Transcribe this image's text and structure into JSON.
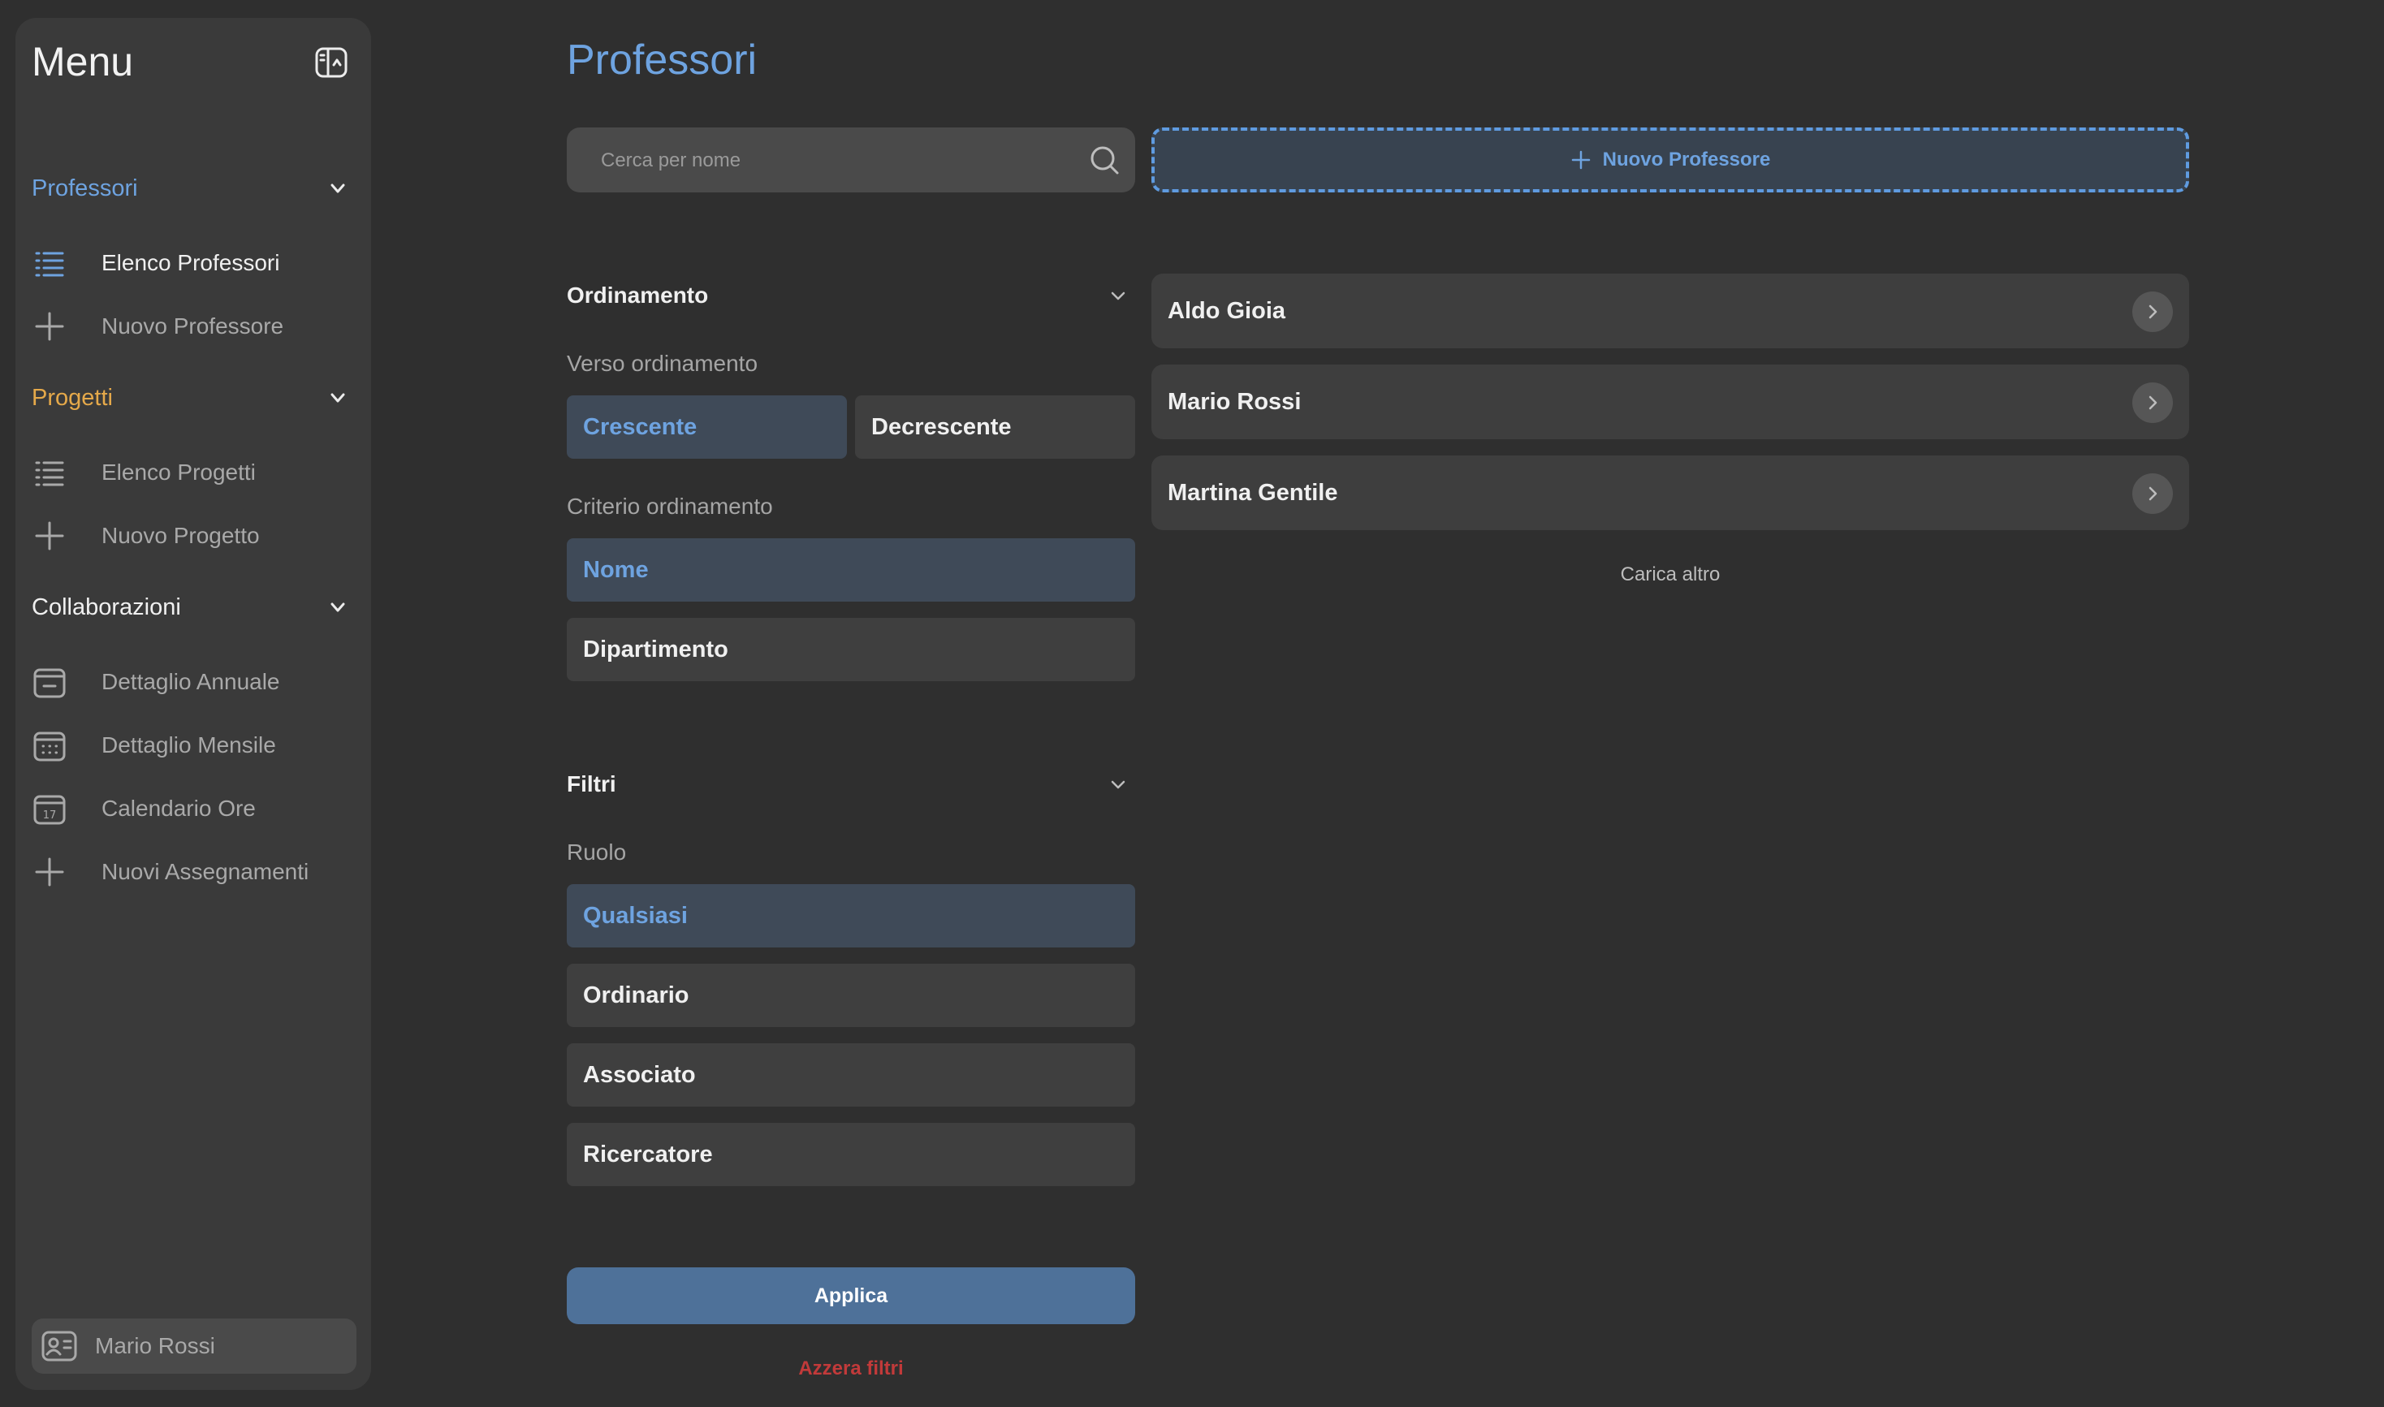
{
  "sidebar": {
    "title": "Menu",
    "sections": [
      {
        "label": "Professori",
        "color": "#6ea3e0",
        "items": [
          {
            "label": "Elenco Professori",
            "icon": "list-icon",
            "active": true
          },
          {
            "label": "Nuovo Professore",
            "icon": "plus-icon",
            "active": false
          }
        ]
      },
      {
        "label": "Progetti",
        "color": "#e5a94a",
        "items": [
          {
            "label": "Elenco Progetti",
            "icon": "list-icon",
            "active": false
          },
          {
            "label": "Nuovo Progetto",
            "icon": "plus-icon",
            "active": false
          }
        ]
      },
      {
        "label": "Collaborazioni",
        "color": "#f0f0f0",
        "items": [
          {
            "label": "Dettaglio Annuale",
            "icon": "calendar-minus-icon",
            "active": false
          },
          {
            "label": "Dettaglio Mensile",
            "icon": "calendar-grid-icon",
            "active": false
          },
          {
            "label": "Calendario Ore",
            "icon": "calendar-day-icon",
            "active": false
          },
          {
            "label": "Nuovi Assegnamenti",
            "icon": "plus-icon",
            "active": false
          }
        ]
      }
    ],
    "user": {
      "name": "Mario Rossi",
      "icon": "id-card-icon"
    }
  },
  "main": {
    "title": "Professori",
    "search": {
      "placeholder": "Cerca per nome",
      "value": ""
    },
    "new_button_label": "Nuovo Professore",
    "sorting": {
      "heading": "Ordinamento",
      "direction_label": "Verso ordinamento",
      "direction_options": [
        "Crescente",
        "Decrescente"
      ],
      "direction_selected": "Crescente",
      "criteria_label": "Criterio ordinamento",
      "criteria_options": [
        "Nome",
        "Dipartimento"
      ],
      "criteria_selected": "Nome"
    },
    "filters": {
      "heading": "Filtri",
      "role_label": "Ruolo",
      "role_options": [
        "Qualsiasi",
        "Ordinario",
        "Associato",
        "Ricercatore"
      ],
      "role_selected": "Qualsiasi"
    },
    "apply_label": "Applica",
    "reset_label": "Azzera filtri",
    "professors": [
      "Aldo Gioia",
      "Mario Rossi",
      "Martina Gentile"
    ],
    "load_more_label": "Carica altro"
  },
  "colors": {
    "accent": "#6ea3e0",
    "projects": "#e5a94a",
    "danger": "#c23a3a",
    "apply": "#4e7199"
  }
}
